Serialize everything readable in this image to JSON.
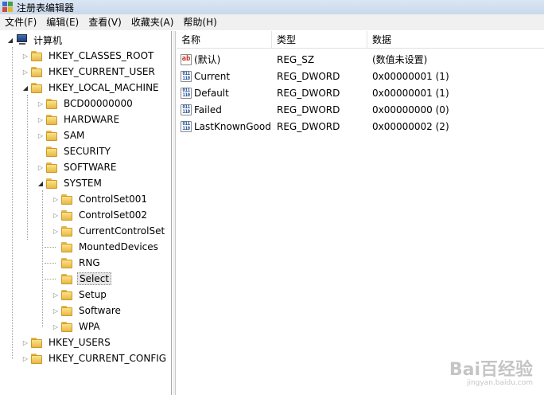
{
  "window": {
    "title": "注册表编辑器"
  },
  "menu": [
    {
      "label": "文件(F)"
    },
    {
      "label": "编辑(E)"
    },
    {
      "label": "查看(V)"
    },
    {
      "label": "收藏夹(A)"
    },
    {
      "label": "帮助(H)"
    }
  ],
  "tree": {
    "root": "计算机",
    "hkcr": "HKEY_CLASSES_ROOT",
    "hkcu": "HKEY_CURRENT_USER",
    "hklm": "HKEY_LOCAL_MACHINE",
    "bcd": "BCD00000000",
    "hardware": "HARDWARE",
    "sam": "SAM",
    "security": "SECURITY",
    "software": "SOFTWARE",
    "system": "SYSTEM",
    "cs001": "ControlSet001",
    "cs002": "ControlSet002",
    "ccs": "CurrentControlSet",
    "mounted": "MountedDevices",
    "rng": "RNG",
    "select": "Select",
    "setup": "Setup",
    "software2": "Software",
    "wpa": "WPA",
    "hku": "HKEY_USERS",
    "hkcc": "HKEY_CURRENT_CONFIG"
  },
  "list": {
    "headers": {
      "name": "名称",
      "type": "类型",
      "data": "数据"
    },
    "rows": [
      {
        "icon": "string-value-icon",
        "name": "(默认)",
        "type": "REG_SZ",
        "data": "(数值未设置)"
      },
      {
        "icon": "binary-value-icon",
        "name": "Current",
        "type": "REG_DWORD",
        "data": "0x00000001 (1)"
      },
      {
        "icon": "binary-value-icon",
        "name": "Default",
        "type": "REG_DWORD",
        "data": "0x00000001 (1)"
      },
      {
        "icon": "binary-value-icon",
        "name": "Failed",
        "type": "REG_DWORD",
        "data": "0x00000000 (0)"
      },
      {
        "icon": "binary-value-icon",
        "name": "LastKnownGood",
        "type": "REG_DWORD",
        "data": "0x00000002 (2)"
      }
    ]
  },
  "icons": {
    "string_glyph": "ab",
    "binary_glyph_top": "011",
    "binary_glyph_bottom": "110"
  },
  "watermark": {
    "logo": "Bai百经验",
    "sub": "jingyan.baidu.com"
  }
}
